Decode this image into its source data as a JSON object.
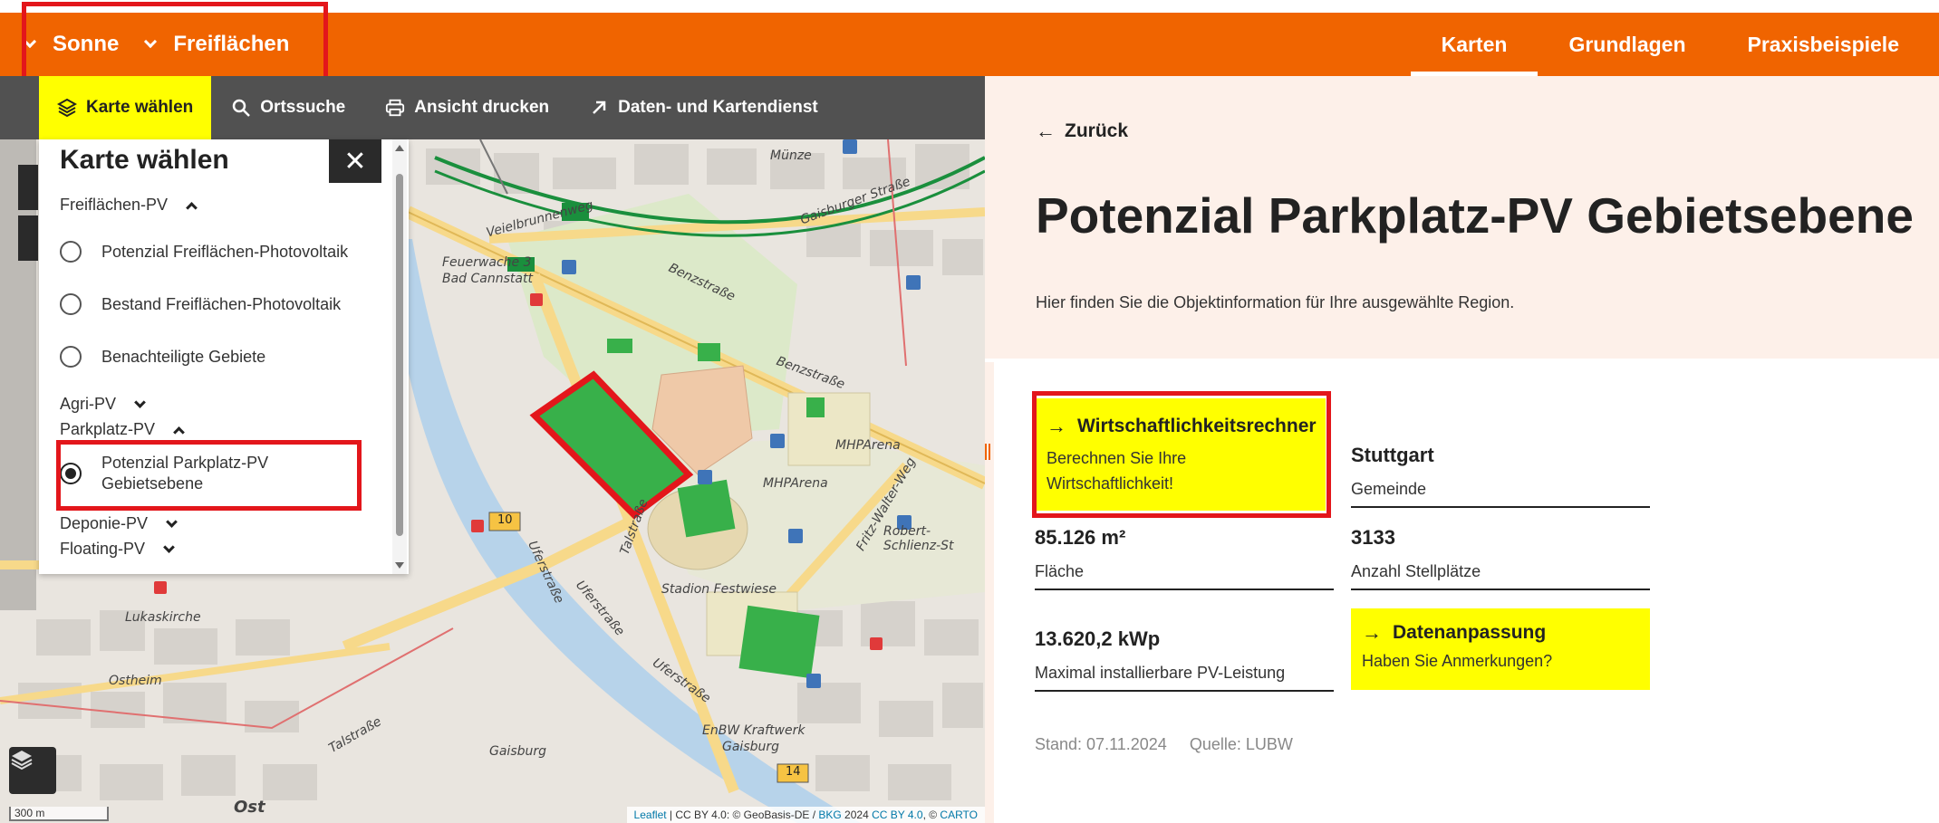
{
  "header": {
    "left_items": [
      {
        "label": "Sonne"
      },
      {
        "label": "Freiflächen"
      }
    ],
    "right_items": [
      {
        "label": "Karten",
        "active": true
      },
      {
        "label": "Grundlagen",
        "active": false
      },
      {
        "label": "Praxisbeispiele",
        "active": false
      }
    ],
    "accent_color": "#f06400"
  },
  "toolbar": {
    "karte_waehlen": "Karte wählen",
    "ortssuche": "Ortssuche",
    "ansicht_drucken": "Ansicht drucken",
    "daten_kartendienst": "Daten- und Kartendienst"
  },
  "panel": {
    "title": "Karte wählen",
    "close_icon": "close-icon",
    "groups": {
      "freiflaechen": {
        "label": "Freiflächen-PV",
        "expanded": true,
        "options": [
          {
            "label": "Potenzial Freiflächen-Photovoltaik",
            "checked": false
          },
          {
            "label": "Bestand Freiflächen-Photovoltaik",
            "checked": false
          },
          {
            "label": "Benachteiligte Gebiete",
            "checked": false
          }
        ]
      },
      "agri": {
        "label": "Agri-PV",
        "expanded": false
      },
      "parkplatz": {
        "label": "Parkplatz-PV",
        "expanded": true,
        "options": [
          {
            "label": "Potenzial Parkplatz-PV Gebietsebene",
            "checked": true
          }
        ]
      },
      "deponie": {
        "label": "Deponie-PV",
        "expanded": false
      },
      "floating": {
        "label": "Floating-PV",
        "expanded": false
      }
    }
  },
  "map": {
    "labels": {
      "feuerwache": "Feuerwache 3",
      "bad_cannstatt": "Bad Cannstatt",
      "benzstrasse1": "Benzstraße",
      "benzstrasse2": "Benzstraße",
      "mhparena1": "MHPArena",
      "mhparena2": "MHPArena",
      "stadion_festwiese": "Stadion Festwiese",
      "uferstrasse1": "Uferstraße",
      "uferstrasse2": "Uferstraße",
      "uferstrasse3": "Uferstraße",
      "talstrasse1": "Talstraße",
      "talstrasse2": "Talstraße",
      "robert_schlienz": "Robert-Schlienz-St",
      "fritz_walter": "Fritz-Walter-Weg",
      "enbw": "EnBW Kraftwerk",
      "gaisburg1": "Gaisburg",
      "gaisburg2": "Gaisburg",
      "ostheim": "Ostheim",
      "lukaskirche": "Lukaskirche",
      "ost": "Ost",
      "muenze": "Münze",
      "gaisburger_str": "Gaisburger Straße",
      "veielbrunnenweg": "Veielbrunnenweg",
      "route10": "10",
      "route14": "14"
    },
    "scale": "300 m",
    "attribution": {
      "leaflet": "Leaflet",
      "text1": " | CC BY 4.0: © GeoBasis-DE / ",
      "bkg": "BKG",
      "text2": " 2024 ",
      "ccby": "CC BY 4.0",
      "text3": ", © ",
      "carto": "CARTO"
    },
    "layers_icon": "layers-icon"
  },
  "info": {
    "back_label": "Zurück",
    "title": "Potenzial Parkplatz-PV Gebietsebene",
    "subtitle": "Hier finden Sie die Objektinformation für Ihre ausgewählte Region.",
    "rechner": {
      "title": "Wirtschaftlichkeitsrechner",
      "desc_line1": "Berechnen Sie Ihre",
      "desc_line2": "Wirtschaftlichkeit!"
    },
    "gemeinde": {
      "value": "Stuttgart",
      "label": "Gemeinde"
    },
    "flaeche": {
      "value": "85.126 m²",
      "label": "Fläche"
    },
    "stellplaetze": {
      "value": "3133",
      "label": "Anzahl Stellplätze"
    },
    "leistung": {
      "value": "13.620,2 kWp",
      "label": "Maximal installierbare PV-Leistung"
    },
    "datenanpassung": {
      "title": "Datenanpassung",
      "desc": "Haben Sie Anmerkungen?"
    },
    "stand": "Stand: 07.11.2024",
    "quelle": "Quelle: LUBW"
  }
}
